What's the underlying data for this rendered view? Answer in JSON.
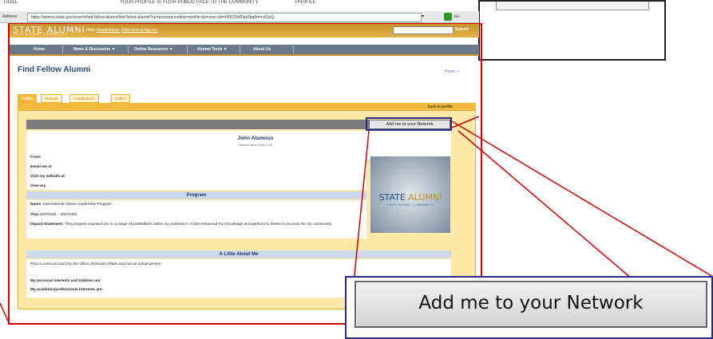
{
  "topstrip": {
    "left_text": "GOAL",
    "mid_text": "YOUR PROFILE IS YOUR PUBLIC FACE TO THE COMMUNITY",
    "right_text": "PROFILE"
  },
  "browser": {
    "address_label": "Address",
    "url": "https://alumni.state.gov/search/find-fellow-alumni/find-fellow-alumni?op=account;module=profile;do=view;uid=A6K3DoRlay5bq9n=niX3zQ",
    "go_label": "Go"
  },
  "site": {
    "logo_text": "STATE ALUMNI",
    "logo_sub": "YOUR GLOBAL COMMUNITY",
    "hello_prefix": "Hello",
    "hello_user": "lanealumnus.",
    "logout_link": "Click here to log out.",
    "search_label": "Search"
  },
  "nav": {
    "items": [
      "Home",
      "News & Discussion ▼",
      "Online Resources ▼",
      "Alumni Tools ▼",
      "About Us"
    ]
  },
  "page": {
    "title": "Find Fellow Alumni",
    "home_link": "Home >"
  },
  "tabs": [
    "Profile",
    "Network",
    "Contributions",
    "Gallery"
  ],
  "profile": {
    "back_link": "back to profile",
    "add_button": "Add me to your Network",
    "name": "John Alumnus",
    "member_since": "Member Since 2008-02-05",
    "fields": {
      "from": "From:",
      "email": "Email me at",
      "website": "Visit my website at",
      "view": "View my"
    },
    "program_heading": "Program",
    "program_name_label": "Name:",
    "program_name": "International Visitor Leadership Program",
    "year_label": "Year:",
    "year": "20070201 - 20070401",
    "impact_label": "Impact Statement:",
    "impact_text": "This program exposed me to a range of possibilities within my profession. It has enhanced my knowledge and pertied my desire to do more for my community.",
    "about_heading": "A Little About Me",
    "about_text": "This is a test account for the Office of Alumni Affairs and not an actual person.",
    "interests_personal": "My personal interests and hobbies are:",
    "interests_academic": "My academic/professional interests are:"
  },
  "logo_image": {
    "state": "STATE",
    "alumni": "ALUMNI",
    "sub": "YOUR GLOBAL COMMUNITY"
  },
  "callout": {
    "button_label": "Add me to your Network"
  },
  "colors": {
    "accent_gold": "#c7922a",
    "tab_orange": "#f2b83a",
    "highlight_red": "#d40000",
    "highlight_blue": "#2a2a8a",
    "nav_gray": "#6a7a8c"
  }
}
